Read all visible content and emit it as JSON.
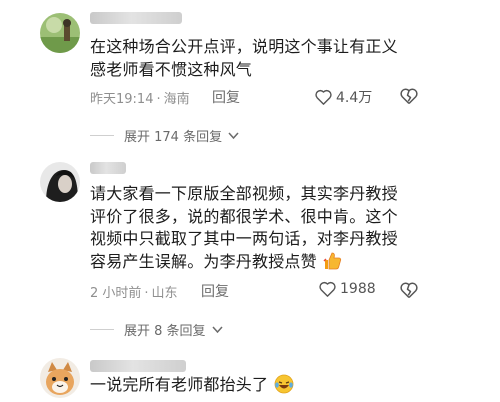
{
  "comments": [
    {
      "text_lines": [
        "在这种场合公开点评，说明这个事让有正义",
        "感老师看不惯这种风气"
      ],
      "time": "昨天19:14",
      "location": "海南",
      "reply_label": "回复",
      "likes": "4.4万",
      "expand_label": "展开 174 条回复"
    },
    {
      "text_lines": [
        "请大家看一下原版全部视频，其实李丹教授",
        "评价了很多，说的都很学术、很中肯。这个",
        "视频中只截取了其中一两句话，对李丹教授",
        "容易产生误解。为李丹教授点赞"
      ],
      "time": "2 小时前",
      "location": "山东",
      "reply_label": "回复",
      "likes": "1988",
      "expand_label": "展开 8 条回复"
    },
    {
      "text_lines": [
        "一说完所有老师都抬头了"
      ]
    }
  ],
  "icons": {
    "like": "heart-outline-icon",
    "dislike": "broken-heart-icon",
    "expand": "chevron-down-icon",
    "thumbs_up_emoji": "thumbs-up-emoji",
    "laugh_emoji": "laughing-tears-emoji"
  },
  "colors": {
    "meta": "#8f8f8f",
    "text": "#1c1c1c",
    "emoji_yellow": "#f7b731"
  }
}
